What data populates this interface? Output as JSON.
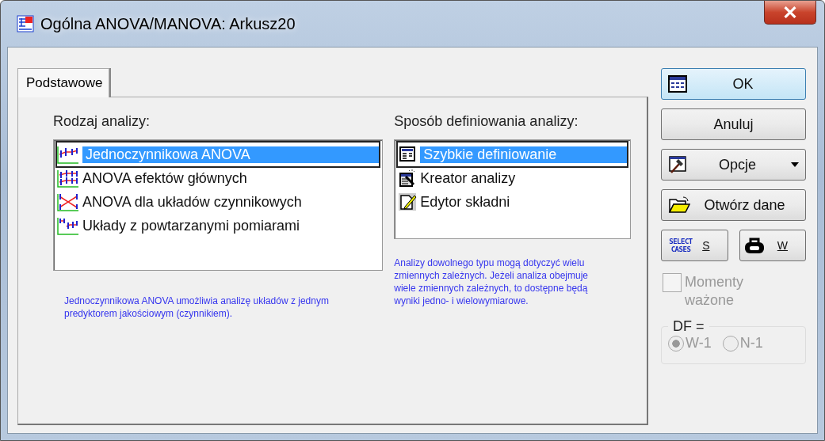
{
  "window": {
    "title": "Ogólna ANOVA/MANOVA: Arkusz20"
  },
  "tabs": [
    {
      "label": "Podstawowe",
      "selected": true
    }
  ],
  "analysis_type": {
    "label": "Rodzaj analizy:",
    "items": [
      {
        "kind": "one-way",
        "label": "Jednoczynnikowa ANOVA",
        "selected": true
      },
      {
        "kind": "main-effects",
        "label": "ANOVA efektów głównych",
        "selected": false
      },
      {
        "kind": "factorial",
        "label": "ANOVA dla układów czynnikowych",
        "selected": false
      },
      {
        "kind": "repeated",
        "label": "Układy z powtarzanymi pomiarami",
        "selected": false
      }
    ],
    "description": "Jednoczynnikowa ANOVA umożliwia analizę układów z jednym predyktorem jakościowym (czynnikiem)."
  },
  "definition_method": {
    "label": "Sposób definiowania analizy:",
    "items": [
      {
        "kind": "quick",
        "label": "Szybkie definiowanie",
        "selected": true
      },
      {
        "kind": "wizard",
        "label": "Kreator analizy",
        "selected": false
      },
      {
        "kind": "syntax",
        "label": "Edytor składni",
        "selected": false
      }
    ],
    "description": "Analizy dowolnego typu mogą dotyczyć wielu zmiennych zależnych. Jeżeli analiza obejmuje wiele zmiennych zależnych, to dostępne będą wyniki jedno- i wielowymiarowe."
  },
  "buttons": [
    {
      "kind": "ok",
      "label": "OK"
    },
    {
      "kind": "plain",
      "label": "Anuluj"
    },
    {
      "kind": "dropdown",
      "label": "Opcje"
    },
    {
      "kind": "open",
      "label": "Otwórz dane"
    }
  ],
  "small_buttons": [
    {
      "kind": "select-cases",
      "icon_text": "SELECT CASES",
      "label": "S"
    },
    {
      "kind": "weight",
      "label": "W"
    }
  ],
  "weighted_moments": {
    "label": "Momenty ważone",
    "checked": false,
    "disabled": true
  },
  "df": {
    "label": "DF =",
    "disabled": true,
    "options": [
      {
        "label": "W-1",
        "selected": true
      },
      {
        "label": "N-1",
        "selected": false
      }
    ]
  }
}
